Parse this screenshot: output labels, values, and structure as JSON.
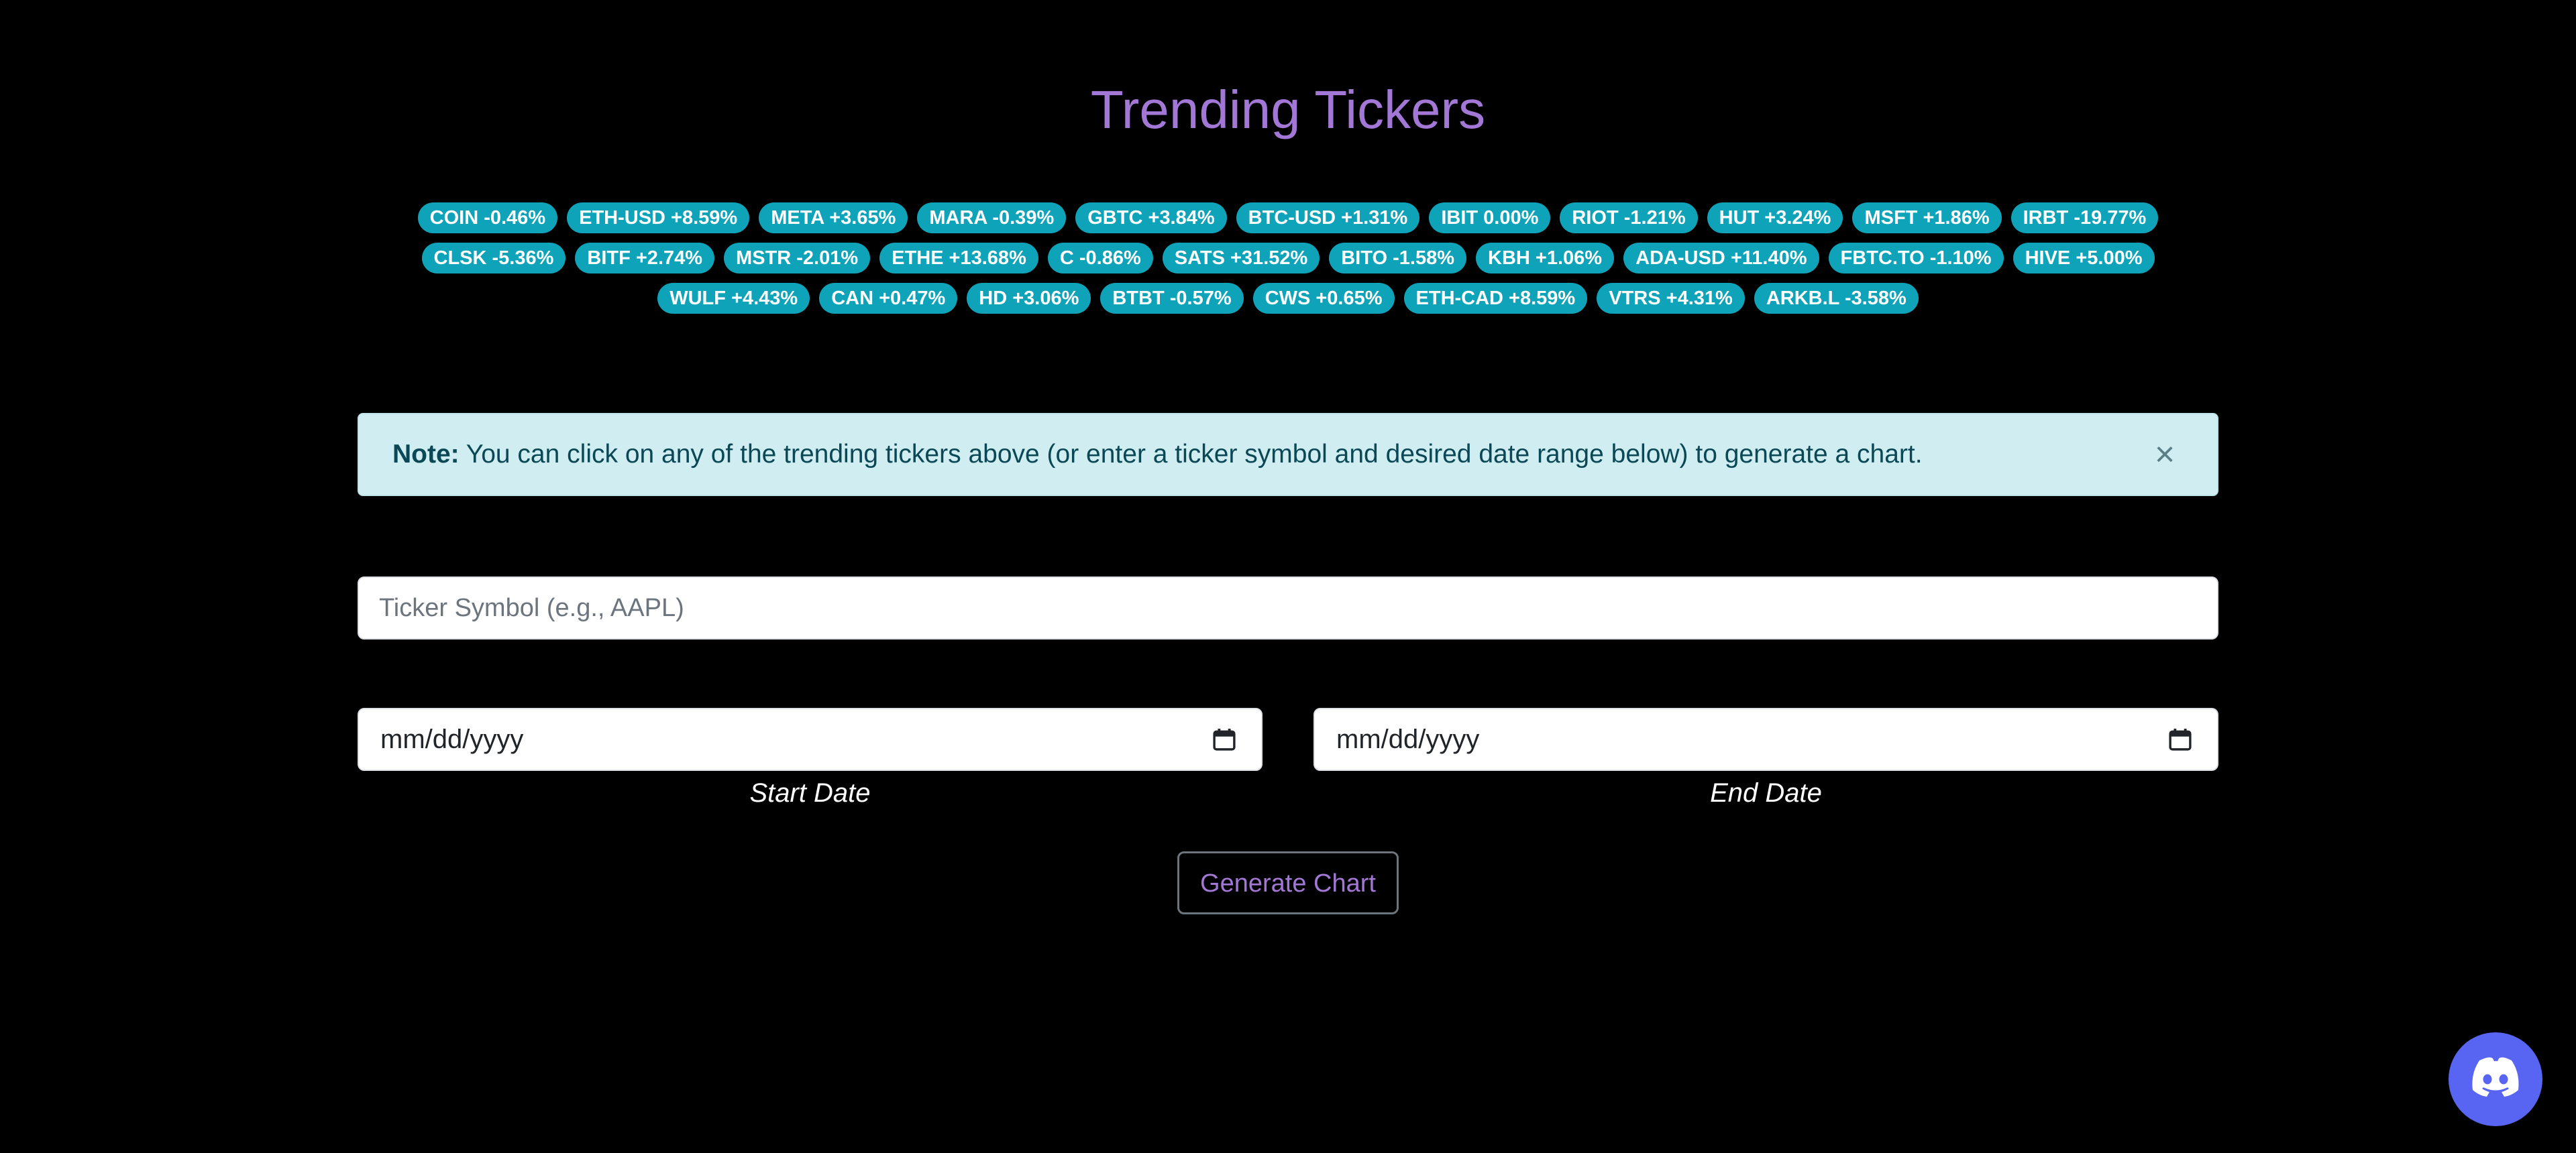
{
  "header": {
    "title": "Trending Tickers"
  },
  "tickers": [
    "COIN -0.46%",
    "ETH-USD +8.59%",
    "META +3.65%",
    "MARA -0.39%",
    "GBTC +3.84%",
    "BTC-USD +1.31%",
    "IBIT 0.00%",
    "RIOT -1.21%",
    "HUT +3.24%",
    "MSFT +1.86%",
    "IRBT -19.77%",
    "CLSK -5.36%",
    "BITF +2.74%",
    "MSTR -2.01%",
    "ETHE +13.68%",
    "C -0.86%",
    "SATS +31.52%",
    "BITO -1.58%",
    "KBH +1.06%",
    "ADA-USD +11.40%",
    "FBTC.TO -1.10%",
    "HIVE +5.00%",
    "WULF +4.43%",
    "CAN +0.47%",
    "HD +3.06%",
    "BTBT -0.57%",
    "CWS +0.65%",
    "ETH-CAD +8.59%",
    "VTRS +4.31%",
    "ARKB.L -3.58%"
  ],
  "note": {
    "label": "Note:",
    "text": " You can click on any of the trending tickers above (or enter a ticker symbol and desired date range below) to generate a chart.",
    "close_symbol": "×"
  },
  "form": {
    "ticker_placeholder": "Ticker Symbol (e.g., AAPL)",
    "start_date_value": "mm/dd/yyyy",
    "start_date_label": "Start Date",
    "end_date_value": "mm/dd/yyyy",
    "end_date_label": "End Date",
    "generate_label": "Generate Chart"
  },
  "icons": {
    "calendar": "calendar-icon",
    "close": "close-icon",
    "discord": "discord-icon"
  },
  "colors": {
    "background": "#000000",
    "title": "#a277d6",
    "ticker_badge": "#0fa3b9",
    "note_background": "#d0eef2",
    "note_text": "#0b4855",
    "discord": "#5865f2"
  }
}
